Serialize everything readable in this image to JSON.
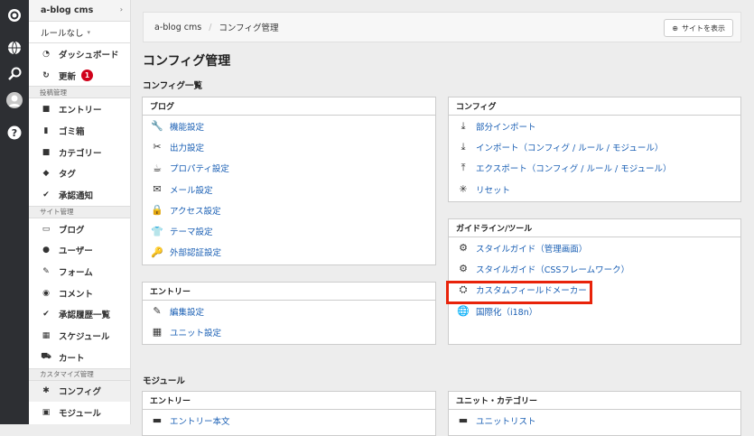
{
  "icon_rail": [
    {
      "name": "logo-icon",
      "glyph": "๑"
    },
    {
      "name": "globe-icon",
      "glyph": "🌐"
    },
    {
      "name": "search-icon",
      "glyph": "🔍"
    },
    {
      "name": "avatar-icon",
      "glyph": "●"
    },
    {
      "name": "help-icon",
      "glyph": "?"
    }
  ],
  "sidebar": {
    "site_name": "a-blog cms",
    "site_arrow": "›",
    "rule_label": "ルールなし",
    "rule_caret": "▾",
    "top_items": [
      {
        "label": "ダッシュボード",
        "icon": "◔",
        "icon_name": "dashboard-icon"
      },
      {
        "label": "更新",
        "icon": "↻",
        "icon_name": "update-icon",
        "badge": "1"
      }
    ],
    "sections": [
      {
        "title": "投稿管理",
        "items": [
          {
            "label": "エントリー",
            "icon": "■",
            "icon_name": "entry-icon"
          },
          {
            "label": "ゴミ箱",
            "icon": "▮",
            "icon_name": "trash-icon"
          },
          {
            "label": "カテゴリー",
            "icon": "■",
            "icon_name": "category-icon"
          },
          {
            "label": "タグ",
            "icon": "◆",
            "icon_name": "tag-icon"
          },
          {
            "label": "承認通知",
            "icon": "✔",
            "icon_name": "check-icon"
          }
        ]
      },
      {
        "title": "サイト管理",
        "items": [
          {
            "label": "ブログ",
            "icon": "▭",
            "icon_name": "blog-icon"
          },
          {
            "label": "ユーザー",
            "icon": "●",
            "icon_name": "user-icon"
          },
          {
            "label": "フォーム",
            "icon": "✎",
            "icon_name": "form-icon"
          },
          {
            "label": "コメント",
            "icon": "◉",
            "icon_name": "comment-icon"
          },
          {
            "label": "承認履歴一覧",
            "icon": "✔",
            "icon_name": "check-icon"
          },
          {
            "label": "スケジュール",
            "icon": "▦",
            "icon_name": "calendar-icon"
          },
          {
            "label": "カート",
            "icon": "⛟",
            "icon_name": "cart-icon"
          }
        ]
      },
      {
        "title": "カスタマイズ管理",
        "items": [
          {
            "label": "コンフィグ",
            "icon": "✱",
            "icon_name": "gear-icon",
            "active": true
          },
          {
            "label": "モジュール",
            "icon": "▣",
            "icon_name": "module-icon"
          }
        ]
      }
    ]
  },
  "breadcrumb": {
    "root": "a-blog cms",
    "separator": "/",
    "current": "コンフィグ管理",
    "show_site": "サイトを表示",
    "show_site_icon": "⊕"
  },
  "page_title": "コンフィグ管理",
  "config_list_heading": "コンフィグ一覧",
  "panels": {
    "blog": {
      "title": "ブログ",
      "rows": [
        {
          "label": "機能設定",
          "icon": "🔧",
          "icon_name": "wrench-icon"
        },
        {
          "label": "出力設定",
          "icon": "✂",
          "icon_name": "output-icon"
        },
        {
          "label": "プロパティ設定",
          "icon": "☕",
          "icon_name": "property-icon"
        },
        {
          "label": "メール設定",
          "icon": "✉",
          "icon_name": "mail-icon"
        },
        {
          "label": "アクセス設定",
          "icon": "🔒",
          "icon_name": "lock-icon"
        },
        {
          "label": "テーマ設定",
          "icon": "👕",
          "icon_name": "theme-icon"
        },
        {
          "label": "外部認証設定",
          "icon": "🔑",
          "icon_name": "key-icon"
        }
      ]
    },
    "config": {
      "title": "コンフィグ",
      "rows": [
        {
          "label": "部分インポート",
          "icon": "⤓",
          "icon_name": "import-icon"
        },
        {
          "label": "インポート（コンフィグ / ルール / モジュール）",
          "icon": "⤓",
          "icon_name": "import-icon"
        },
        {
          "label": "エクスポート（コンフィグ / ルール / モジュール）",
          "icon": "⤒",
          "icon_name": "export-icon"
        },
        {
          "label": "リセット",
          "icon": "✳",
          "icon_name": "reset-icon"
        }
      ]
    },
    "entry": {
      "title": "エントリー",
      "rows": [
        {
          "label": "編集設定",
          "icon": "✎",
          "icon_name": "edit-icon"
        },
        {
          "label": "ユニット設定",
          "icon": "▦",
          "icon_name": "unit-icon"
        }
      ]
    },
    "guidelines": {
      "title": "ガイドライン/ツール",
      "rows": [
        {
          "label": "スタイルガイド（管理画面）",
          "icon": "⚙",
          "icon_name": "gears-icon"
        },
        {
          "label": "スタイルガイド（CSSフレームワーク）",
          "icon": "⚙",
          "icon_name": "gears-icon"
        },
        {
          "label": "カスタムフィールドメーカー",
          "icon": "⛭",
          "icon_name": "maker-icon"
        },
        {
          "label": "国際化（i18n）",
          "icon": "🌐",
          "icon_name": "globe-icon"
        }
      ]
    }
  },
  "module_heading": "モジュール",
  "module_panels": {
    "entry": {
      "title": "エントリー",
      "first_row": "エントリー本文"
    },
    "unit": {
      "title": "ユニット・カテゴリー",
      "first_row": "ユニットリスト"
    }
  },
  "colors": {
    "link": "#1a5fb4",
    "highlight": "#e8230a",
    "badge": "#d0021b"
  }
}
